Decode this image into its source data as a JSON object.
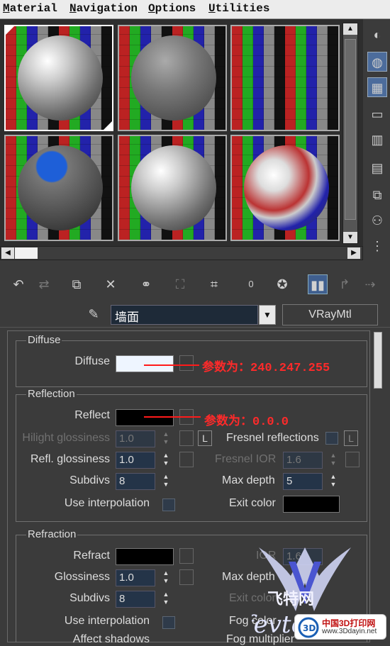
{
  "menu": {
    "material": "Material",
    "navigation": "Navigation",
    "options": "Options",
    "utilities": "Utilities"
  },
  "material_name": "墙面",
  "material_type": "VRayMtl",
  "diffuse": {
    "group_title": "Diffuse",
    "diffuse_label": "Diffuse",
    "diffuse_color": "#eef5ff",
    "note": "参数为：240.247.255"
  },
  "reflection": {
    "group_title": "Reflection",
    "reflect_label": "Reflect",
    "reflect_color": "#000000",
    "note": "参数为：0.0.0",
    "hilight_label": "Hilight glossiness",
    "hilight_value": "1.0",
    "l_button": "L",
    "fresnel_label": "Fresnel reflections",
    "refl_gloss_label": "Refl. glossiness",
    "refl_gloss_value": "1.0",
    "fresnel_ior_label": "Fresnel IOR",
    "fresnel_ior_value": "1.6",
    "subdivs_label": "Subdivs",
    "subdivs_value": "8",
    "max_depth_label": "Max depth",
    "max_depth_value": "5",
    "use_interp_label": "Use interpolation",
    "exit_color_label": "Exit color",
    "exit_color": "#000000"
  },
  "refraction": {
    "group_title": "Refraction",
    "refract_label": "Refract",
    "refract_color": "#000000",
    "ior_label": "IOR",
    "ior_value": "1.6",
    "gloss_label": "Glossiness",
    "gloss_value": "1.0",
    "max_depth_label": "Max depth",
    "subdivs_label": "Subdivs",
    "subdivs_value": "8",
    "exit_color_label": "Exit color",
    "use_interp_label": "Use interpolation",
    "fog_color_label": "Fog color",
    "affect_shadows_label": "Affect shadows",
    "fog_mult_label": "Fog multiplier"
  },
  "watermark": {
    "brand": "飞特网",
    "latin": "fevte",
    "badge_title": "中国3D打印网",
    "badge_url": "www.3Ddayin.net"
  }
}
